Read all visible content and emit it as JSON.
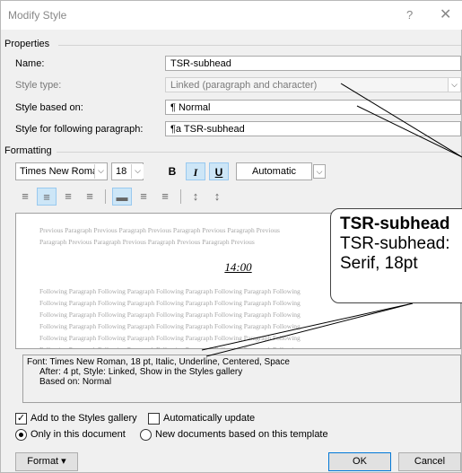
{
  "window": {
    "title": "Modify Style",
    "help": "?",
    "close": "✕"
  },
  "properties": {
    "section": "Properties",
    "name_label": "Name:",
    "name_value": "TSR-subhead",
    "style_type_label": "Style type:",
    "style_type_value": "Linked (paragraph and character)",
    "based_on_label": "Style based on:",
    "based_on_value": "¶ Normal",
    "following_label": "Style for following paragraph:",
    "following_value": "¶a TSR-subhead"
  },
  "formatting": {
    "section": "Formatting",
    "font": "Times New Roman",
    "size": "18",
    "bold": "B",
    "italic": "I",
    "underline": "U",
    "color": "Automatic"
  },
  "preview": {
    "previous_1": "Previous Paragraph Previous Paragraph Previous Paragraph Previous Paragraph Previous",
    "previous_2": "Paragraph Previous Paragraph Previous Paragraph Previous Paragraph Previous",
    "sample": "14:00",
    "following_line": "Following Paragraph Following Paragraph Following Paragraph Following Paragraph Following"
  },
  "description": {
    "line1": "Font: Times New Roman, 18 pt, Italic, Underline, Centered, Space",
    "line2": "After:  4 pt, Style: Linked, Show in the Styles gallery",
    "line3": "Based on: Normal"
  },
  "options": {
    "add_gallery": "Add to the Styles gallery",
    "auto_update": "Automatically update",
    "only_doc": "Only in this document",
    "new_docs": "New documents based on this template"
  },
  "buttons": {
    "format": "Format ▾",
    "ok": "OK",
    "cancel": "Cancel"
  },
  "callout": {
    "title": "TSR-subhead",
    "line1": "TSR-subhead:",
    "line2": "Serif, 18pt"
  }
}
